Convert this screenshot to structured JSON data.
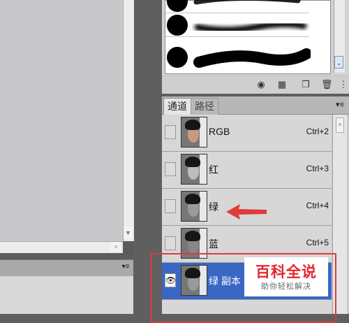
{
  "channels_panel": {
    "tabs": [
      {
        "label": "通道",
        "active": true
      },
      {
        "label": "路径",
        "active": false
      }
    ],
    "channels": [
      {
        "name": "RGB",
        "shortcut": "Ctrl+2",
        "visible": false,
        "selected": false
      },
      {
        "name": "红",
        "shortcut": "Ctrl+3",
        "visible": false,
        "selected": false
      },
      {
        "name": "绿",
        "shortcut": "Ctrl+4",
        "visible": false,
        "selected": false
      },
      {
        "name": "蓝",
        "shortcut": "Ctrl+5",
        "visible": false,
        "selected": false
      },
      {
        "name": "绿 副本",
        "shortcut": "",
        "visible": true,
        "selected": true
      }
    ]
  },
  "watermark": {
    "title": "百科全说",
    "subtitle": "助你轻松解决"
  },
  "icons": {
    "eye": "eye-icon",
    "panel_menu": "panel-menu-icon",
    "brush_footer": [
      "eye-brush-icon",
      "grid-icon",
      "new-brush-icon",
      "trash-icon"
    ]
  },
  "colors": {
    "selection": "#3a66c4",
    "annotation_red": "#e03a3a",
    "watermark_red": "#e3262e"
  }
}
